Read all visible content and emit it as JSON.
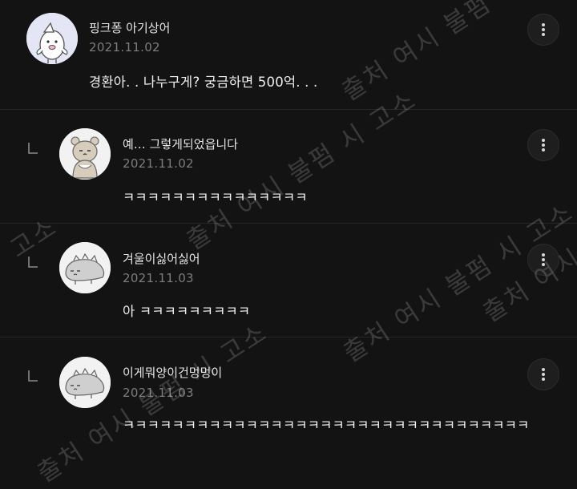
{
  "comments": [
    {
      "author": "핑크퐁 아기상어",
      "date": "2021.11.02",
      "text": "경환아. . 나누구게? 궁금하면 500억. . .",
      "is_reply": false,
      "avatar_icon": "baby-shark-avatar-icon"
    },
    {
      "author": "예… 그렇게되었읍니다",
      "date": "2021.11.02",
      "text": "ㅋㅋㅋㅋㅋㅋㅋㅋㅋㅋㅋㅋㅋㅋㅋ",
      "is_reply": true,
      "avatar_icon": "bear-avatar-icon"
    },
    {
      "author": "겨울이싫어싫어",
      "date": "2021.11.03",
      "text": "아 ㅋㅋㅋㅋㅋㅋㅋㅋㅋ",
      "is_reply": true,
      "avatar_icon": "dinosaur-avatar-icon"
    },
    {
      "author": "이게뭐양이건멍멍이",
      "date": "2021.11.03",
      "text": "ㅋㅋㅋㅋㅋㅋㅋㅋㅋㅋㅋㅋㅋㅋㅋㅋㅋㅋㅋㅋㅋㅋㅋㅋㅋㅋㅋㅋㅋㅋㅋㅋㅋ",
      "is_reply": true,
      "avatar_icon": "dinosaur-avatar-icon"
    }
  ],
  "watermark": {
    "text": "출처 여시 불펌 시 고소",
    "text_fragment": "고소"
  },
  "icons": {
    "more": "more-vertical-icon",
    "reply": "reply-corner-icon"
  },
  "colors": {
    "background": "#131313",
    "divider": "#262626",
    "date": "#7d7d7d"
  }
}
